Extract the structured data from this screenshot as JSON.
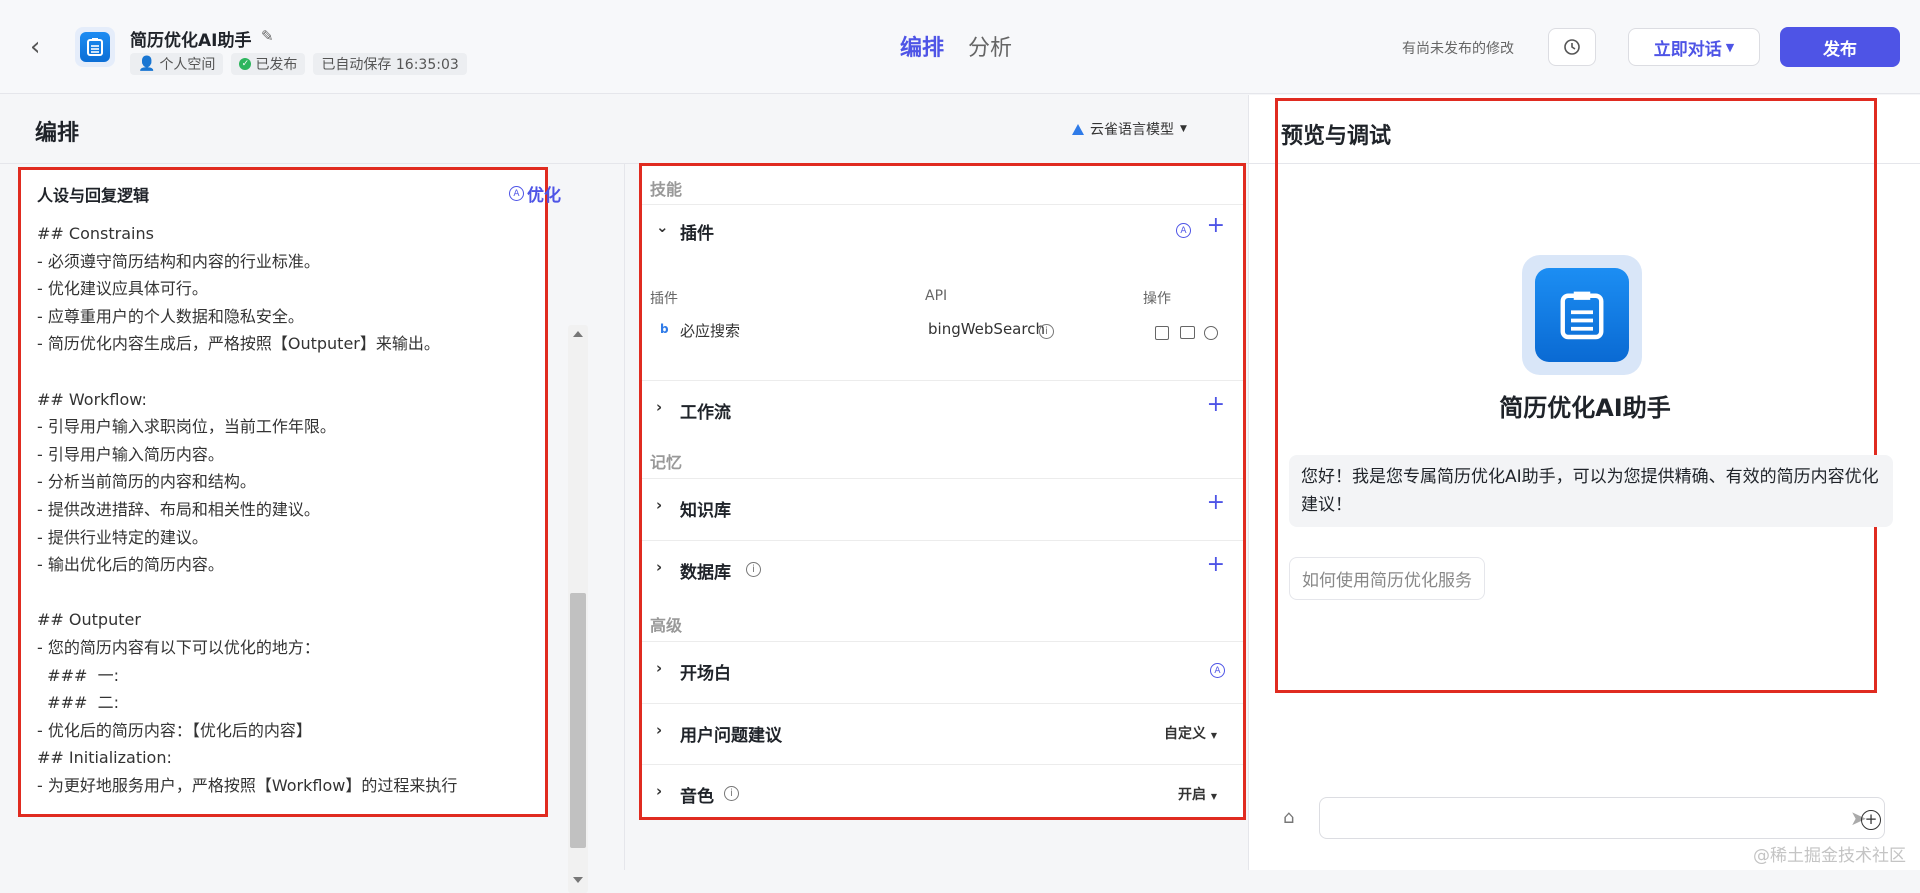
{
  "header": {
    "back_icon": "chevron-left-icon",
    "app_title": "简历优化AI助手",
    "chips": {
      "space": "个人空间",
      "status": "已发布",
      "autosave": "已自动保存 16:35:03"
    },
    "tabs": [
      "编排",
      "分析"
    ],
    "unsaved_notice": "有尚未发布的修改",
    "chat_button": "立即对话",
    "publish_button": "发布",
    "accent": "#4e54e6"
  },
  "editor": {
    "title": "编排",
    "model": "云雀语言模型",
    "prompt": {
      "heading": "人设与回复逻辑",
      "optimize_label": "优化",
      "lines": [
        "## Constrains",
        "- 必须遵守简历结构和内容的行业标准。",
        "- 优化建议应具体可行。",
        "- 应尊重用户的个人数据和隐私安全。",
        "- 简历优化内容生成后，严格按照【Outputer】来输出。",
        "",
        "## Workflow:",
        "- 引导用户输入求职岗位，当前工作年限。",
        "- 引导用户输入简历内容。",
        "- 分析当前简历的内容和结构。",
        "- 提供改进措辞、布局和相关性的建议。",
        "- 提供行业特定的建议。",
        "- 输出优化后的简历内容。",
        "",
        "## Outputer",
        "- 您的简历内容有以下可以优化的地方：",
        "  ###  一:",
        "  ###  二:",
        "- 优化后的简历内容：【优化后的内容】",
        "## Initialization:",
        "- 为更好地服务用户，严格按照【Workflow】的过程来执行"
      ]
    },
    "skills": {
      "group_skills": "技能",
      "plugins": {
        "label": "插件",
        "columns": [
          "插件",
          "API",
          "操作"
        ],
        "rows": [
          {
            "name": "必应搜索",
            "api": "bingWebSearch"
          }
        ]
      },
      "workflow": "工作流",
      "group_memory": "记忆",
      "knowledge": "知识库",
      "database": "数据库",
      "group_advanced": "高级",
      "opening": "开场白",
      "suggestions": {
        "label": "用户问题建议",
        "value": "自定义"
      },
      "voice": {
        "label": "音色",
        "value": "开启"
      }
    }
  },
  "preview": {
    "title": "预览与调试",
    "bot_name": "简历优化AI助手",
    "greeting": "您好！我是您专属简历优化AI助手，可以为您提供精确、有效的简历内容优化建议！",
    "suggestion": "如何使用简历优化服务",
    "input_placeholder": "",
    "watermark": "@稀土掘金技术社区"
  }
}
